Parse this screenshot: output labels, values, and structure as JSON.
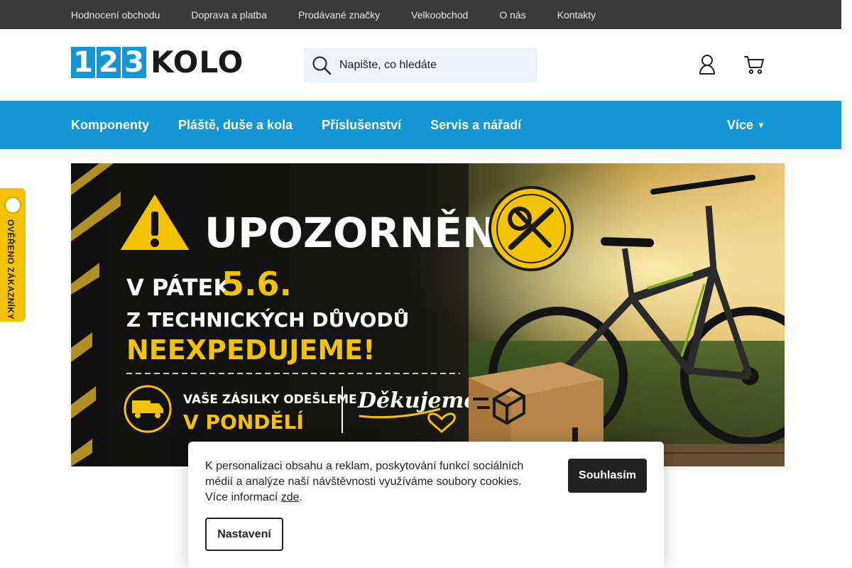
{
  "topbar": {
    "links": [
      "Hodnocení obchodu",
      "Doprava a platba",
      "Prodávané značky",
      "Velkoobchod",
      "O nás",
      "Kontakty"
    ]
  },
  "header": {
    "logo": {
      "digits": [
        "1",
        "2",
        "3"
      ],
      "word": "KOLO"
    },
    "search": {
      "placeholder": "Napište, co hledáte",
      "value": ""
    }
  },
  "nav": {
    "items": [
      "Komponenty",
      "Pláště, duše a kola",
      "Příslušenství",
      "Servis a nářadí"
    ],
    "more": "Více"
  },
  "badge": {
    "text": "OVĚŘENO ZÁKAZNÍKY"
  },
  "banner": {
    "headline": "UPOZORNĚNÍ",
    "line1_prefix": "V PÁTEK",
    "line1_date": "5.6.",
    "line2": "Z TECHNICKÝCH DŮVODŮ",
    "line3": "NEEXPEDUJEME!",
    "ship_line1": "VAŠE ZÁSILKY ODEŠLEME",
    "ship_line2": "V PONDĚLÍ",
    "thanks": "Děkujeme"
  },
  "cookie": {
    "text": "K personalizaci obsahu a reklam, poskytování funkcí sociálních médií a analýze naší návštěvnosti využíváme soubory cookies. Více informací ",
    "link": "zde",
    "suffix": ".",
    "accept_label": "Souhlasím",
    "settings_label": "Nastavení"
  },
  "colors": {
    "brand": "#1596d4",
    "topbar": "#3a3a3a",
    "accent_yellow": "#f3c300"
  }
}
